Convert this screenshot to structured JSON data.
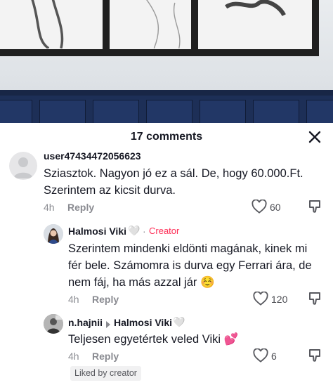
{
  "header": {
    "title": "17 comments",
    "close_icon": "close-icon"
  },
  "comments": [
    {
      "username": "user47434472056623",
      "lines": [
        "Sziasztok. Nagyon jó ez a sál. De, hogy 60.000.Ft.",
        "Szerintem az kicsit durva."
      ],
      "time": "4h",
      "reply_label": "Reply",
      "likes": "60"
    },
    {
      "username": "Halmosi Viki",
      "heart": "🤍",
      "sep": "·",
      "tag": "Creator",
      "lines": [
        "Szerintem mindenki eldönti magának, kinek mi",
        "fér bele. Számomra is durva egy Ferrari ára, de",
        "nem fáj, ha más azzal jár ☺️"
      ],
      "time": "4h",
      "reply_label": "Reply",
      "likes": "120"
    },
    {
      "username": "n.hajnii",
      "reply_to": "Halmosi Viki",
      "heart": "🤍",
      "lines": [
        "Teljesen egyetértek veled Viki 💕"
      ],
      "time": "4h",
      "reply_label": "Reply",
      "likes": "6",
      "badge": "Liked by creator"
    }
  ],
  "colors": {
    "accent": "#fe2c55",
    "muted": "#8a8b91",
    "text": "#161823"
  }
}
